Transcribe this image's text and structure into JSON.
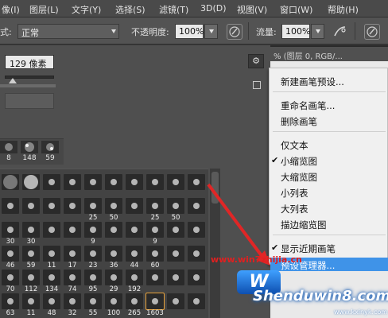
{
  "menubar": {
    "items": [
      "像(I)",
      "图层(L)",
      "文字(Y)",
      "选择(S)",
      "滤镜(T)",
      "3D(D)",
      "视图(V)",
      "窗口(W)",
      "帮助(H)"
    ]
  },
  "options": {
    "mode_label": "式:",
    "mode_value": "正常",
    "opacity_label": "不透明度:",
    "opacity_value": "100%",
    "flow_label": "流量:",
    "flow_value": "100%"
  },
  "brush_panel": {
    "size_value": "129 像素",
    "recent_sizes": [
      "8",
      "148",
      "59"
    ],
    "grid_rows": [
      [
        "",
        "",
        "",
        "",
        "",
        "",
        "",
        "",
        "",
        ""
      ],
      [
        "",
        "",
        "",
        "",
        "25",
        "50",
        "",
        "25",
        "50",
        ""
      ],
      [
        "30",
        "30",
        "",
        "",
        "9",
        "",
        "",
        "9",
        "",
        ""
      ],
      [
        "46",
        "59",
        "11",
        "17",
        "23",
        "36",
        "44",
        "60",
        "",
        ""
      ],
      [
        "70",
        "112",
        "134",
        "74",
        "95",
        "29",
        "192",
        "",
        "",
        ""
      ],
      [
        "63",
        "11",
        "48",
        "32",
        "55",
        "100",
        "265",
        "1603",
        "",
        ""
      ]
    ]
  },
  "document": {
    "tab_title": "% (图层 0, RGB/..."
  },
  "context_menu": {
    "items": [
      {
        "label": "新建画笔预设...",
        "checked": false
      },
      {
        "label": "重命名画笔...",
        "checked": false
      },
      {
        "label": "删除画笔",
        "checked": false
      },
      {
        "label": "仅文本",
        "checked": false
      },
      {
        "label": "小缩览图",
        "checked": true
      },
      {
        "label": "大缩览图",
        "checked": false
      },
      {
        "label": "小列表",
        "checked": false
      },
      {
        "label": "大列表",
        "checked": false
      },
      {
        "label": "描边缩览图",
        "checked": false
      },
      {
        "label": "显示近期画笔",
        "checked": true
      },
      {
        "label": "预设管理器...",
        "checked": false
      }
    ]
  },
  "watermarks": {
    "url": "www.win7zhijia.cn",
    "brand": "Shenduwin8.com",
    "site": "www.kxinyk.com"
  },
  "colors": {
    "highlight": "#3f93e8",
    "annotation_arrow": "#e02626"
  }
}
